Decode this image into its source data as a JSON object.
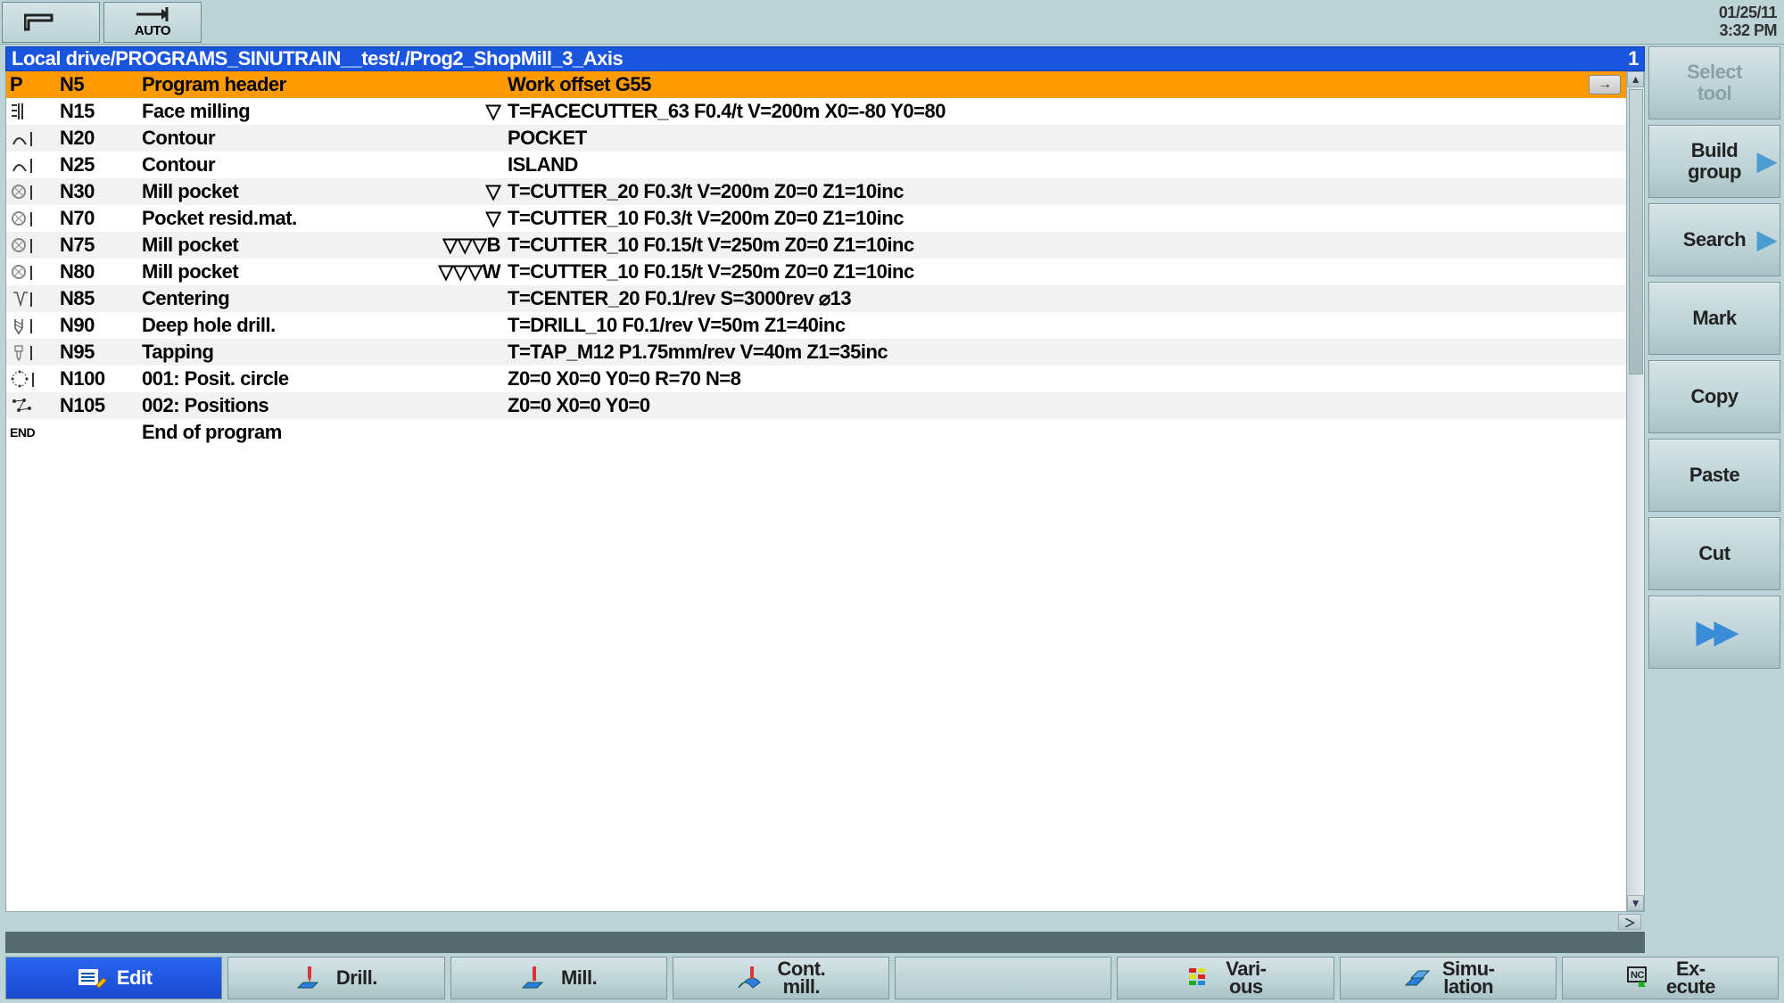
{
  "header": {
    "mode_label": "AUTO",
    "date": "01/25/11",
    "time": "3:32 PM"
  },
  "path_bar": {
    "path": "Local drive/PROGRAMS_SINUTRAIN__test/./Prog2_ShopMill_3_Axis",
    "right": "1"
  },
  "program": {
    "lines": [
      {
        "icon": "P",
        "seq": "N5",
        "op": "Program header",
        "sym": "",
        "params": "Work offset G55",
        "selected": true
      },
      {
        "icon": "face",
        "seq": "N15",
        "op": "Face milling",
        "sym": "▽",
        "params": "T=FACECUTTER_63 F0.4/t V=200m X0=-80 Y0=80"
      },
      {
        "icon": "cont",
        "seq": "N20",
        "op": "Contour",
        "sym": "",
        "params": "POCKET"
      },
      {
        "icon": "cont",
        "seq": "N25",
        "op": "Contour",
        "sym": "",
        "params": "ISLAND"
      },
      {
        "icon": "mill",
        "seq": "N30",
        "op": "Mill pocket",
        "sym": "▽",
        "params": "T=CUTTER_20 F0.3/t V=200m Z0=0 Z1=10inc"
      },
      {
        "icon": "mill",
        "seq": "N70",
        "op": "Pocket resid.mat.",
        "sym": "▽",
        "params": "T=CUTTER_10 F0.3/t V=200m Z0=0 Z1=10inc"
      },
      {
        "icon": "mill",
        "seq": "N75",
        "op": "Mill pocket",
        "sym": "▽▽▽B",
        "params": "T=CUTTER_10 F0.15/t V=250m Z0=0 Z1=10inc"
      },
      {
        "icon": "mill",
        "seq": "N80",
        "op": "Mill pocket",
        "sym": "▽▽▽W",
        "params": "T=CUTTER_10 F0.15/t V=250m Z0=0 Z1=10inc"
      },
      {
        "icon": "cent",
        "seq": "N85",
        "op": "Centering",
        "sym": "",
        "params": "T=CENTER_20 F0.1/rev S=3000rev ⌀13"
      },
      {
        "icon": "drill",
        "seq": "N90",
        "op": "Deep hole drill.",
        "sym": "",
        "params": "T=DRILL_10 F0.1/rev V=50m Z1=40inc"
      },
      {
        "icon": "tap",
        "seq": "N95",
        "op": "Tapping",
        "sym": "",
        "params": "T=TAP_M12 P1.75mm/rev V=40m Z1=35inc"
      },
      {
        "icon": "pos",
        "seq": "N100",
        "op": "001: Posit. circle",
        "sym": "",
        "params": "Z0=0 X0=0 Y0=0 R=70 N=8"
      },
      {
        "icon": "pos2",
        "seq": "N105",
        "op": "002: Positions",
        "sym": "",
        "params": "Z0=0 X0=0 Y0=0"
      },
      {
        "icon": "END",
        "seq": "",
        "op": "End of program",
        "sym": "",
        "params": ""
      }
    ]
  },
  "vsoftkeys": [
    {
      "label": "Select\ntool",
      "disabled": true
    },
    {
      "label": "Build\ngroup",
      "chev": true
    },
    {
      "label": "Search",
      "chev": true
    },
    {
      "label": "Mark"
    },
    {
      "label": "Copy"
    },
    {
      "label": "Paste"
    },
    {
      "label": "Cut"
    },
    {
      "label": "",
      "fwd": true
    }
  ],
  "hsoftkeys": [
    {
      "label": "Edit",
      "icon": "edit",
      "active": true
    },
    {
      "label": "Drill.",
      "icon": "drill"
    },
    {
      "label": "Mill.",
      "icon": "mill"
    },
    {
      "label": "Cont.\nmill.",
      "icon": "contmill"
    },
    {
      "label": "",
      "empty": true
    },
    {
      "label": "Vari-\nous",
      "icon": "various"
    },
    {
      "label": "Simu-\nlation",
      "icon": "sim"
    },
    {
      "label": "Ex-\necute",
      "icon": "exec"
    }
  ]
}
